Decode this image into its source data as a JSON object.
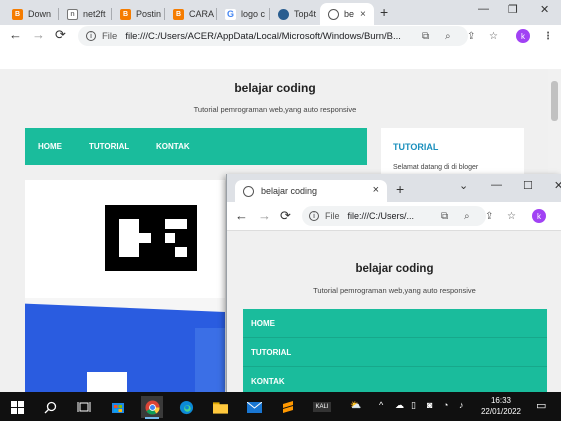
{
  "back_window": {
    "tabs": [
      {
        "label": "Down",
        "icon": "blogger-icon",
        "color": "#f57c00"
      },
      {
        "label": "net2ft",
        "icon": "net2ftp-icon",
        "color": "#777777"
      },
      {
        "label": "Postin",
        "icon": "blogger-icon",
        "color": "#f57c00"
      },
      {
        "label": "CARA",
        "icon": "blogger-icon",
        "color": "#f57c00"
      },
      {
        "label": "logo c",
        "icon": "google-icon",
        "color": "#4285f4"
      },
      {
        "label": "Top4t",
        "icon": "site-icon",
        "color": "#2a5d8f"
      },
      {
        "label": "be",
        "icon": "globe-icon",
        "color": "#555555"
      }
    ],
    "active_tab_close": "×",
    "new_tab": "+",
    "window_controls": {
      "minimize": "—",
      "restore": "❐",
      "close": "✕"
    },
    "toolbar": {
      "back": "←",
      "forward": "→",
      "reload": "⟳",
      "scheme_label": "File",
      "url": "file:///C:/Users/ACER/AppData/Local/Microsoft/Windows/Burn/B...",
      "avatar_letter": "k"
    },
    "page": {
      "title": "belajar coding",
      "subtitle": "Tutorial pemrograman web,yang auto responsive",
      "nav": [
        "HOME",
        "TUTORIAL",
        "KONTAK"
      ],
      "sidebar_heading": "TUTORIAL",
      "sidebar_text": "Selamat datang di di bloger"
    }
  },
  "front_window": {
    "tab_title": "belajar coding",
    "tab_close": "×",
    "new_tab": "+",
    "window_controls": {
      "dropdown": "⌄",
      "minimize": "—",
      "maximize": "☐",
      "close": "✕"
    },
    "toolbar": {
      "back": "←",
      "forward": "→",
      "reload": "⟳",
      "scheme_label": "File",
      "url": "file:///C:/Users/...",
      "avatar_letter": "k"
    },
    "page": {
      "title": "belajar coding",
      "subtitle": "Tutorial pemrograman web,yang auto responsive",
      "menu": [
        "HOME",
        "TUTORIAL",
        "KONTAK"
      ]
    }
  },
  "taskbar": {
    "time": "16:33",
    "date": "22/01/2022",
    "chevron": "^",
    "notification_icon": "▭"
  }
}
